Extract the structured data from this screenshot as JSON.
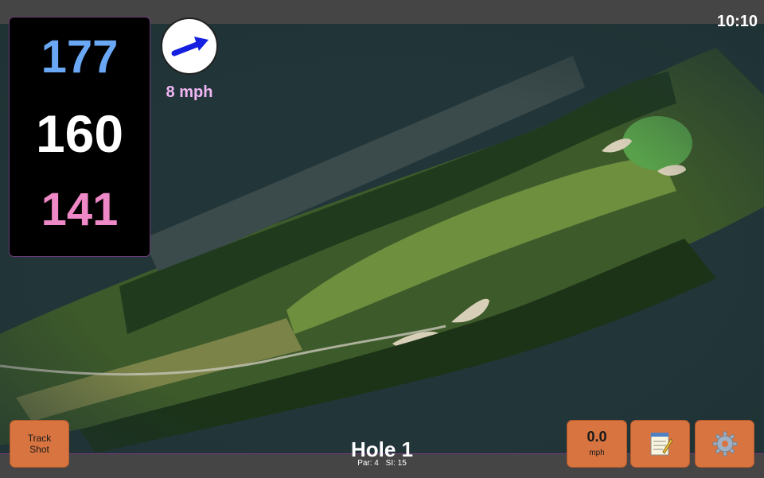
{
  "status": {
    "time": "10:10"
  },
  "distances": {
    "back": "177",
    "middle": "160",
    "front": "141"
  },
  "wind": {
    "speed": "8 mph",
    "direction_icon": "wind-arrow-icon"
  },
  "hole": {
    "title": "Hole 1",
    "par": "Par: 4",
    "si": "SI: 15"
  },
  "controls": {
    "track_shot_line1": "Track",
    "track_shot_line2": "Shot",
    "speed_value": "0.0",
    "speed_unit": "mph",
    "notes_icon": "notepad-icon",
    "settings_icon": "gear-icon"
  },
  "colors": {
    "back_distance": "#6aa8f5",
    "middle_distance": "#ffffff",
    "front_distance": "#ef88c6",
    "button": "#d87440",
    "wind_text": "#f2b6f5"
  }
}
